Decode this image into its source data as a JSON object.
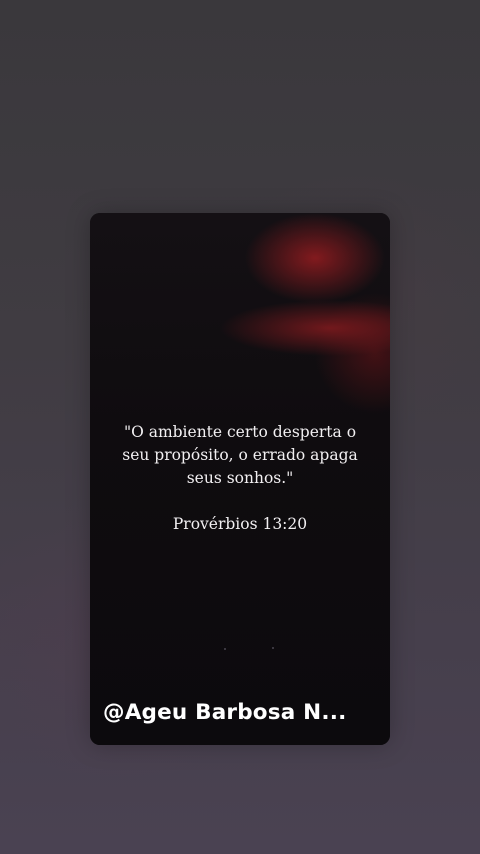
{
  "story": {
    "quote": "\"O ambiente certo desperta o seu propósito, o errado apaga seus sonhos.\"",
    "reference": "Provérbios 13:20",
    "username": "@Ageu Barbosa N..."
  },
  "colors": {
    "background": "#403c42",
    "card": "#0d0b0e",
    "accent_red": "#961c20",
    "text": "#f2f0f2"
  }
}
